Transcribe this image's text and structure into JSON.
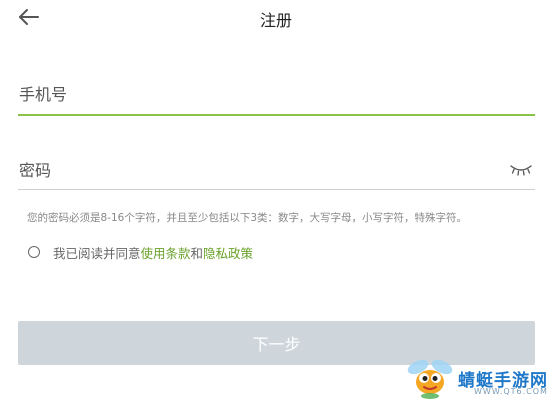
{
  "header": {
    "title": "注册",
    "back_icon": "arrow-left-icon"
  },
  "form": {
    "phone_placeholder": "手机号",
    "password_placeholder": "密码",
    "password_toggle_icon": "eye-closed-icon",
    "password_hint": "您的密码必须是8-16个字符，并且至少包括以下3类：数字，大写字母，小写字符，特殊字符。"
  },
  "agreement": {
    "prefix": "我已阅读并同意",
    "terms_label": "使用条款",
    "conjunction": "和",
    "privacy_label": "隐私政策"
  },
  "actions": {
    "next_label": "下一步"
  },
  "watermark": {
    "brand": "蜻蜓手游网",
    "url": "WWW.QT6.COM"
  },
  "colors": {
    "accent": "#8bc34a",
    "link": "#6aa12a",
    "button_disabled": "#cfd6db",
    "watermark": "#1f78c8"
  }
}
